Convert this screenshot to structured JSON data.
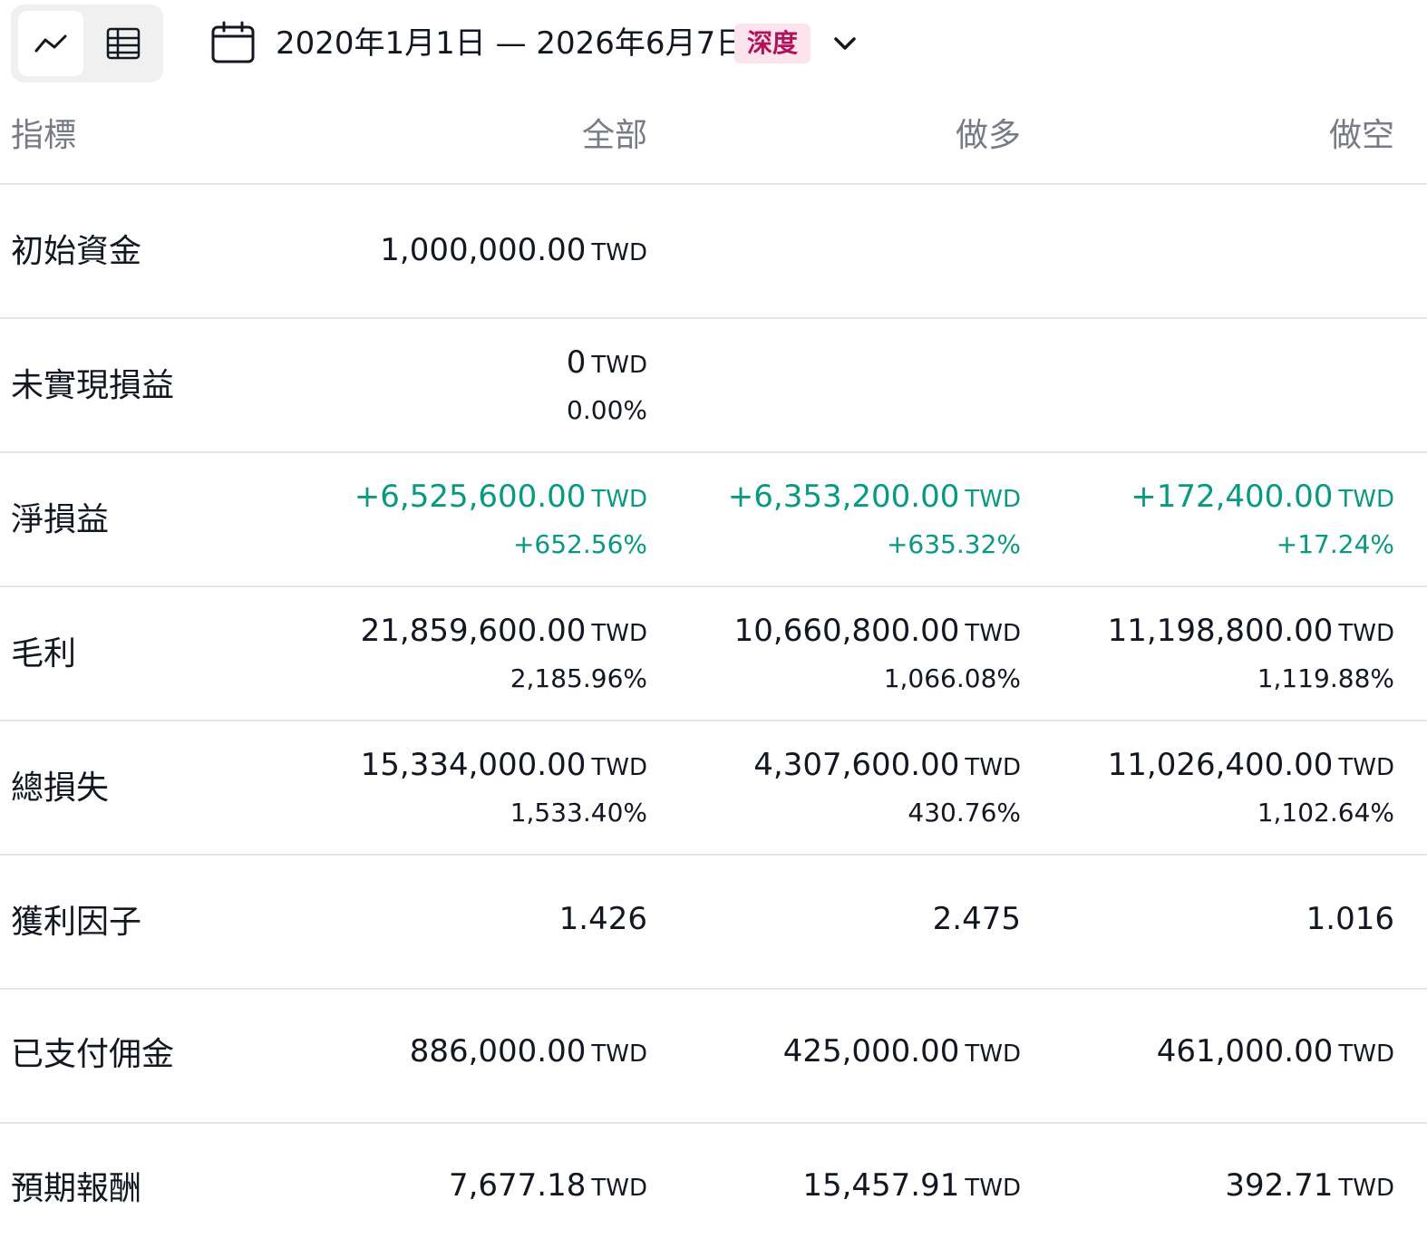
{
  "toolbar": {
    "view_chart_icon": "line-chart-icon",
    "view_table_icon": "table-icon",
    "date_range": "2020年1月1日 — 2026年6月7日",
    "deep_badge": "深度"
  },
  "columns": {
    "metric": "指標",
    "all": "全部",
    "long": "做多",
    "short": "做空"
  },
  "currency": "TWD",
  "rows": {
    "initial_capital": {
      "label": "初始資金",
      "all": "1,000,000.00"
    },
    "unrealized_pnl": {
      "label": "未實現損益",
      "all": "0",
      "all_pct": "0.00%"
    },
    "net_profit": {
      "label": "淨損益",
      "all": "+6,525,600.00",
      "all_pct": "+652.56%",
      "long": "+6,353,200.00",
      "long_pct": "+635.32%",
      "short": "+172,400.00",
      "short_pct": "+17.24%"
    },
    "gross_profit": {
      "label": "毛利",
      "all": "21,859,600.00",
      "all_pct": "2,185.96%",
      "long": "10,660,800.00",
      "long_pct": "1,066.08%",
      "short": "11,198,800.00",
      "short_pct": "1,119.88%"
    },
    "gross_loss": {
      "label": "總損失",
      "all": "15,334,000.00",
      "all_pct": "1,533.40%",
      "long": "4,307,600.00",
      "long_pct": "430.76%",
      "short": "11,026,400.00",
      "short_pct": "1,102.64%"
    },
    "profit_factor": {
      "label": "獲利因子",
      "all": "1.426",
      "long": "2.475",
      "short": "1.016"
    },
    "commission": {
      "label": "已支付佣金",
      "all": "886,000.00",
      "long": "425,000.00",
      "short": "461,000.00"
    },
    "expected_payoff": {
      "label": "預期報酬",
      "all": "7,677.18",
      "long": "15,457.91",
      "short": "392.71"
    }
  },
  "colors": {
    "positive": "#089981",
    "text": "#131722",
    "muted": "#787b86",
    "badge_bg": "#fce4ec",
    "badge_text": "#b0135a"
  }
}
